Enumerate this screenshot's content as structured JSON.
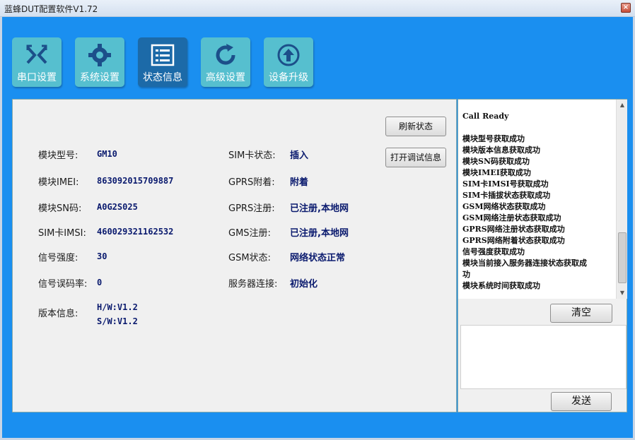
{
  "window": {
    "title": "蓝蜂DUT配置软件V1.72",
    "close": "×"
  },
  "tabs": [
    {
      "label": "串口设置",
      "icon": "shuffle-icon"
    },
    {
      "label": "系统设置",
      "icon": "gear-icon"
    },
    {
      "label": "状态信息",
      "icon": "list-icon"
    },
    {
      "label": "高级设置",
      "icon": "refresh-icon"
    },
    {
      "label": "设备升级",
      "icon": "upload-icon"
    }
  ],
  "status": {
    "module_model_label": "模块型号:",
    "module_model": "GM10",
    "imei_label": "模块IMEI:",
    "imei": "863092015709887",
    "sn_label": "模块SN码:",
    "sn": "A0G2S025",
    "imsi_label": "SIM卡IMSI:",
    "imsi": "460029321162532",
    "signal_label": "信号强度:",
    "signal": "30",
    "ber_label": "信号误码率:",
    "ber": "0",
    "version_label": "版本信息:",
    "hw": "H/W:V1.2",
    "sw": "S/W:V1.2",
    "sim_label": "SIM卡状态:",
    "sim": "插入",
    "gprs_attach_label": "GPRS附着:",
    "gprs_attach": "附着",
    "gprs_reg_label": "GPRS注册:",
    "gprs_reg": "已注册,本地网",
    "gms_reg_label": "GMS注册:",
    "gms_reg": "已注册,本地网",
    "gsm_state_label": "GSM状态:",
    "gsm_state": "网络状态正常",
    "server_label": "服务器连接:",
    "server": "初始化"
  },
  "buttons": {
    "refresh": "刷新状态",
    "debug": "打开调试信息",
    "clear": "清空",
    "send": "发送"
  },
  "log": [
    "Call Ready",
    "",
    "模块型号获取成功",
    "模块版本信息获取成功",
    "模块SN码获取成功",
    "模块IMEI获取成功",
    "SIM卡IMSI号获取成功",
    "SIM卡插拔状态获取成功",
    "GSM网络状态获取成功",
    "GSM网络注册状态获取成功",
    "GPRS网络注册状态获取成功",
    "GPRS网络附着状态获取成功",
    "信号强度获取成功",
    "模块当前接入服务器连接状态获取成",
    "功",
    "模块系统时间获取成功"
  ],
  "colors": {
    "background": "#1a8ff0",
    "tab": "#56bfcf",
    "tab_active": "#1c6aa8",
    "value_text": "#0a1a6e"
  }
}
